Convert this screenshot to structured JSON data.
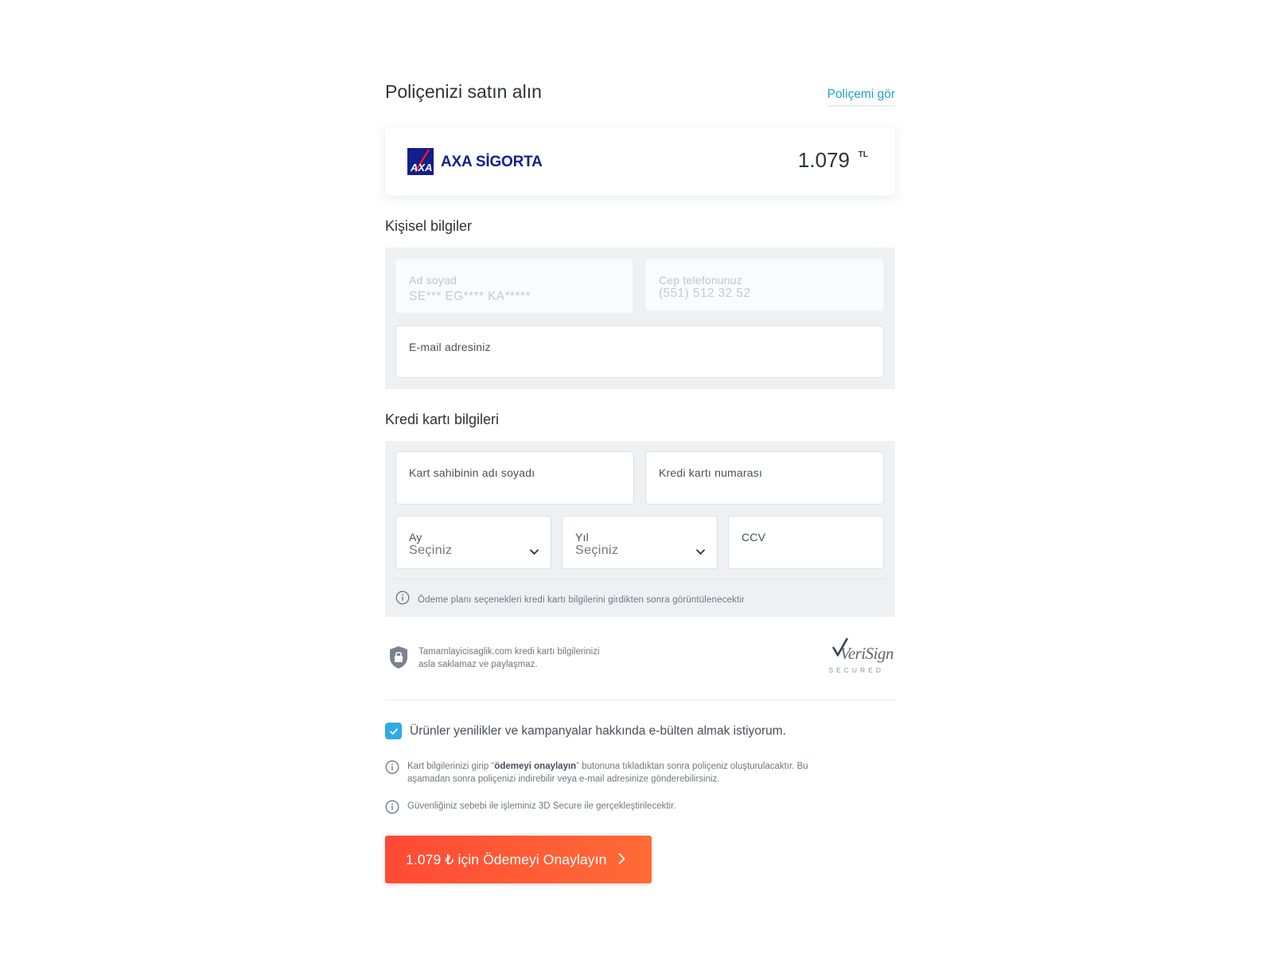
{
  "header": {
    "title": "Poliçenizi satın alın",
    "view_policy_link": "Poliçemi gör"
  },
  "insurer": {
    "brand": "AXA SİGORTA",
    "price": "1.079",
    "currency": "TL",
    "brand_color": "#101f8c"
  },
  "personal": {
    "section_title": "Kişisel bilgiler",
    "name_field": {
      "label": "Ad soyad",
      "value": "SE*** EG**** KA*****"
    },
    "phone_field": {
      "label": "Cep telefonunuz",
      "value": "(551) 512 32 52"
    },
    "email_field": {
      "label": "E-mail adresiniz",
      "value": ""
    }
  },
  "card": {
    "section_title": "Kredi kartı bilgileri",
    "holder_field": {
      "label": "Kart sahibinin adı soyadı",
      "value": ""
    },
    "number_field": {
      "label": "Kredi kartı numarası",
      "value": ""
    },
    "month_field": {
      "label": "Ay",
      "value": "Seçiniz"
    },
    "year_field": {
      "label": "Yıl",
      "value": "Seçiniz"
    },
    "ccv_field": {
      "label": "CCV",
      "value": ""
    },
    "info": "Ödeme planı seçenekleri kredi kartı bilgilerini girdikten sonra görüntülenecektir"
  },
  "security": {
    "line1": "Tamamlayicisaglik.com kredi kartı bilgilerinizi",
    "line2": "asla saklamaz ve paylaşmaz.",
    "verisign_word": "VeriSign",
    "verisign_sub": "SECURED"
  },
  "newsletter": {
    "checked": true,
    "label": "Ürünler yenilikler ve kampanyalar hakkında e-bülten almak istiyorum."
  },
  "notices": {
    "n1_pre": "Kart bilgilerinizi girip “",
    "n1_bold": "ödemeyi onaylayın",
    "n1_post": "” butonuna tıkladıktan sonra poliçeniz oluşturulacaktır. Bu",
    "n1_line2": "aşamadan sonra poliçenizi indirebilir veya e-mail adresinize gönderebilirsiniz.",
    "n2": "Güvenliğiniz sebebi ile işleminiz 3D Secure ile gerçekleştirilecektir."
  },
  "pay_button": {
    "label": "1.079 ₺ için Ödemeyi Onaylayın",
    "color_start": "#ff4a35",
    "color_end": "#ff6b36"
  },
  "colors": {
    "accent_link": "#1aa1d6",
    "checkbox": "#2fa9e8",
    "panel_bg": "#edf1f4"
  }
}
